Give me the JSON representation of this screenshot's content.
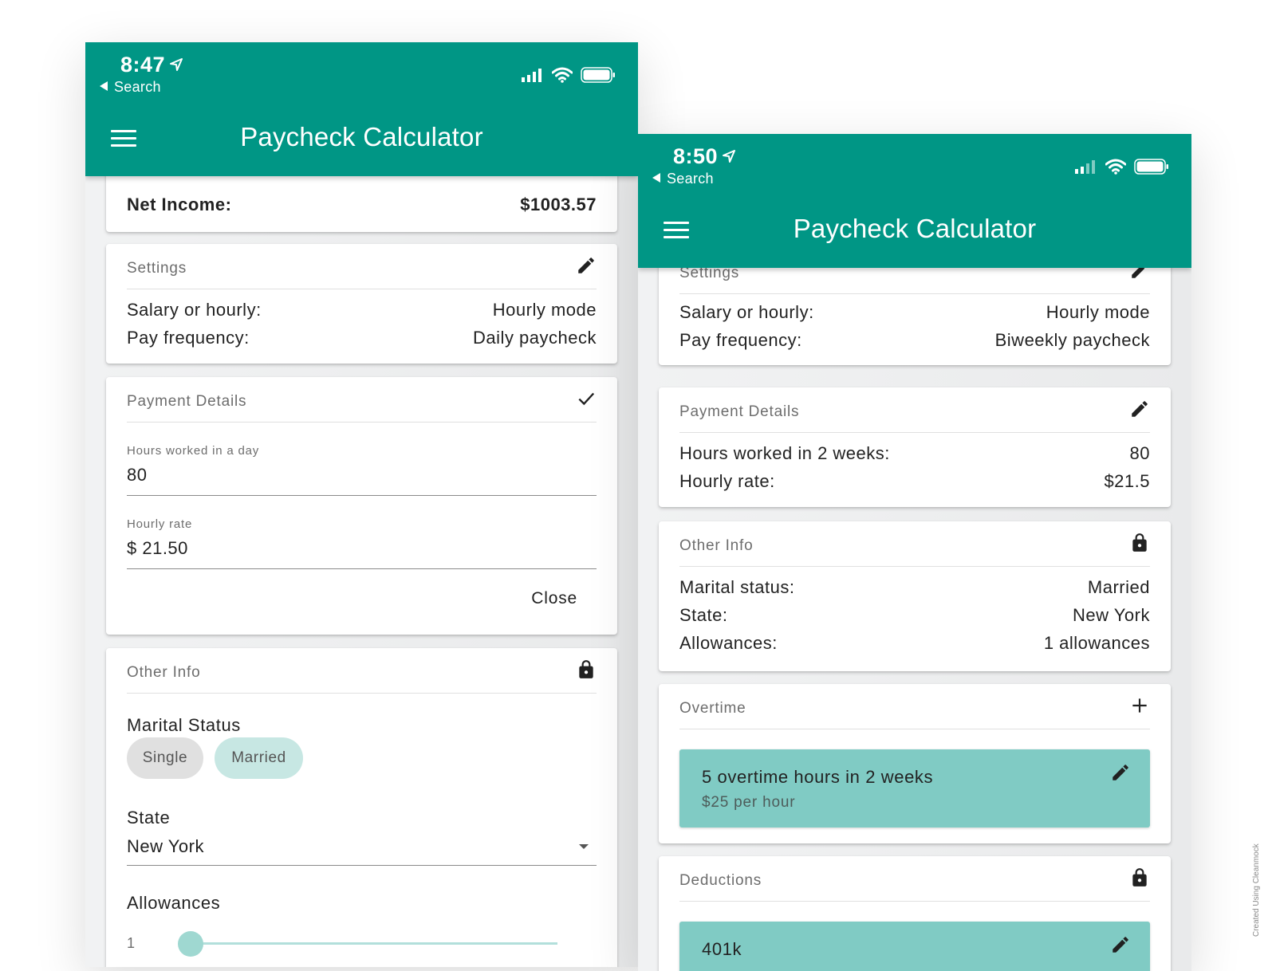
{
  "left": {
    "status": {
      "time": "8:47",
      "back_label": "Search"
    },
    "app_title": "Paycheck Calculator",
    "net_income": {
      "label": "Net Income:",
      "value": "$1003.57"
    },
    "settings": {
      "title": "Settings",
      "rows": [
        {
          "label": "Salary or hourly:",
          "value": "Hourly mode"
        },
        {
          "label": "Pay frequency:",
          "value": "Daily paycheck"
        }
      ]
    },
    "payment_details": {
      "title": "Payment Details",
      "hours_label": "Hours worked in a day",
      "hours_value": "80",
      "rate_label": "Hourly rate",
      "rate_value": "$ 21.50",
      "close_label": "Close"
    },
    "other_info": {
      "title": "Other Info",
      "marital_label": "Marital Status",
      "chips": [
        "Single",
        "Married"
      ],
      "selected_chip": "Married",
      "state_label": "State",
      "state_value": "New York",
      "allowances_label": "Allowances",
      "slider_min": "1",
      "slider_value": 0
    }
  },
  "right": {
    "status": {
      "time": "8:50",
      "back_label": "Search"
    },
    "app_title": "Paycheck Calculator",
    "settings": {
      "title": "Settings",
      "rows": [
        {
          "label": "Salary or hourly:",
          "value": "Hourly mode"
        },
        {
          "label": "Pay frequency:",
          "value": "Biweekly paycheck"
        }
      ]
    },
    "payment_details": {
      "title": "Payment Details",
      "rows": [
        {
          "label": "Hours worked in 2 weeks:",
          "value": "80"
        },
        {
          "label": "Hourly rate:",
          "value": "$21.5"
        }
      ]
    },
    "other_info": {
      "title": "Other Info",
      "rows": [
        {
          "label": "Marital status:",
          "value": "Married"
        },
        {
          "label": "State:",
          "value": "New York"
        },
        {
          "label": "Allowances:",
          "value": "1 allowances"
        }
      ]
    },
    "overtime": {
      "title": "Overtime",
      "item": {
        "title": "5 overtime hours in 2 weeks",
        "subtitle": "$25 per hour"
      }
    },
    "deductions": {
      "title": "Deductions",
      "item": {
        "title": "401k"
      }
    }
  },
  "watermark": "Created Using Cleanmock",
  "colors": {
    "primary": "#009685",
    "chip_selected": "#c7e7e3",
    "sub_card": "#80cbc4",
    "slider": "#9fd8d1"
  },
  "icons": [
    "location-arrow-icon",
    "back-arrow-icon",
    "signal-icon",
    "wifi-icon",
    "battery-icon",
    "menu-icon",
    "pencil-icon",
    "check-icon",
    "lock-icon",
    "plus-icon",
    "dropdown-caret-icon"
  ]
}
